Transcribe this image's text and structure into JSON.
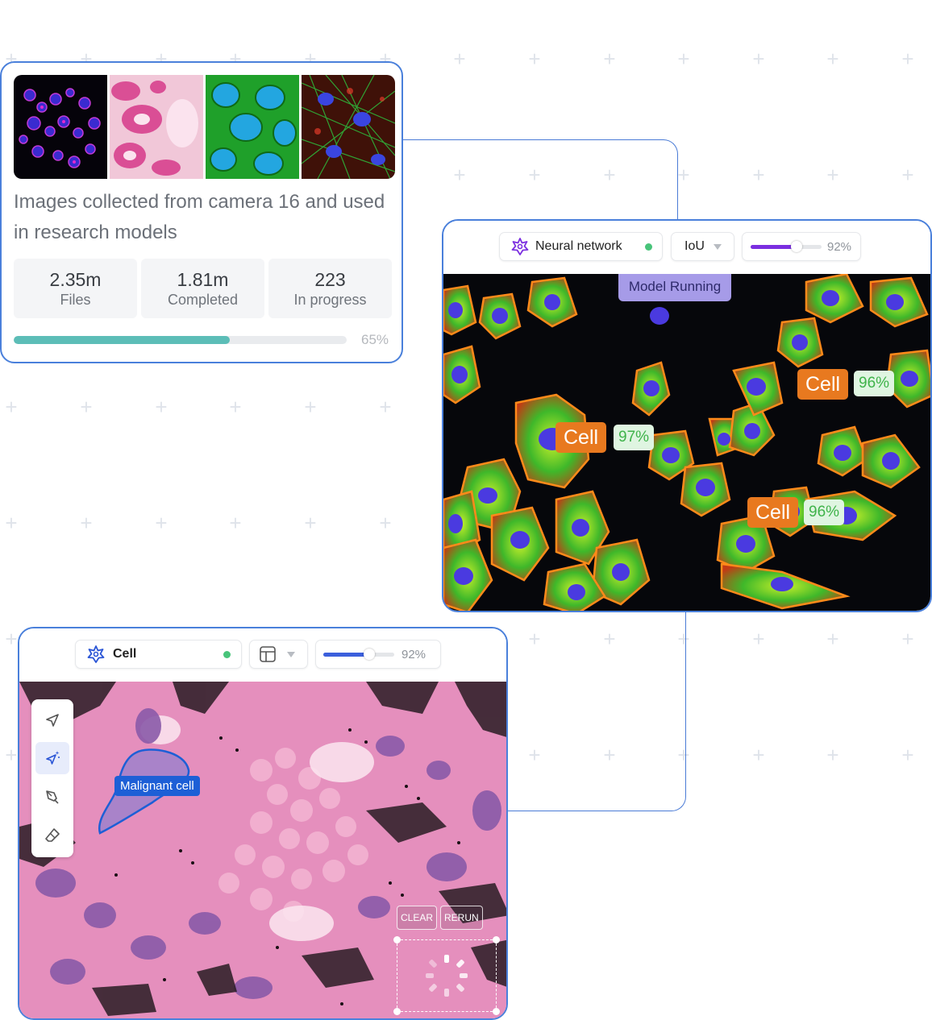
{
  "collection_card": {
    "description": "Images collected from camera 16 and used in research models",
    "stats": [
      {
        "value": "2.35m",
        "label": "Files"
      },
      {
        "value": "1.81m",
        "label": "Completed"
      },
      {
        "value": "223",
        "label": "In progress"
      }
    ],
    "progress": {
      "fraction": 0.65,
      "label": "65%",
      "color": "#5cbdb7"
    }
  },
  "neural_card": {
    "model_selector": {
      "label": "Neural network",
      "icon": "sparkle-icon",
      "status_color": "#48c47a"
    },
    "metric_selector": {
      "label": "IoU"
    },
    "threshold": {
      "fraction": 0.92,
      "label": "92%",
      "color": "#7b2fe0"
    },
    "running_label": "Model Running",
    "detections": [
      {
        "label": "Cell",
        "confidence": "97%"
      },
      {
        "label": "Cell",
        "confidence": "96%"
      },
      {
        "label": "Cell",
        "confidence": "96%"
      }
    ]
  },
  "cell_card": {
    "class_selector": {
      "label": "Cell",
      "icon": "sparkle-icon",
      "status_color": "#48c47a"
    },
    "layout_selector": {
      "icon": "layout-icon"
    },
    "threshold": {
      "fraction": 0.92,
      "label": "92%",
      "color": "#3b5fdc"
    },
    "tools": [
      {
        "icon": "pointer-icon",
        "active": false
      },
      {
        "icon": "magic-pointer-icon",
        "active": true
      },
      {
        "icon": "pen-icon",
        "active": false
      },
      {
        "icon": "eraser-icon",
        "active": false
      }
    ],
    "annotation_label": "Malignant cell",
    "clear_label": "CLEAR",
    "rerun_label": "RERUN"
  }
}
